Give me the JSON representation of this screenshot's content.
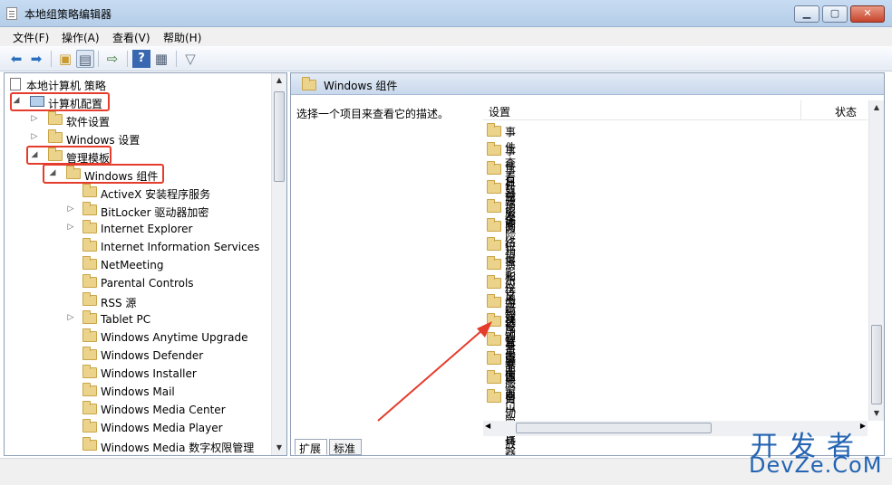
{
  "window": {
    "title": "本地组策略编辑器"
  },
  "menu": [
    "文件(F)",
    "操作(A)",
    "查看(V)",
    "帮助(H)"
  ],
  "tree": {
    "root": "本地计算机 策略",
    "computer_config": "计算机配置",
    "software_settings": "软件设置",
    "windows_settings": "Windows 设置",
    "admin_templates": "管理模板",
    "windows_components": "Windows 组件",
    "children": [
      {
        "label": "ActiveX 安装程序服务",
        "expandable": false
      },
      {
        "label": "BitLocker 驱动器加密",
        "expandable": true
      },
      {
        "label": "Internet Explorer",
        "expandable": true
      },
      {
        "label": "Internet Information Services",
        "expandable": false
      },
      {
        "label": "NetMeeting",
        "expandable": false
      },
      {
        "label": "Parental Controls",
        "expandable": false
      },
      {
        "label": "RSS 源",
        "expandable": false
      },
      {
        "label": "Tablet PC",
        "expandable": true
      },
      {
        "label": "Windows Anytime Upgrade",
        "expandable": false
      },
      {
        "label": "Windows Defender",
        "expandable": false
      },
      {
        "label": "Windows Installer",
        "expandable": false
      },
      {
        "label": "Windows Mail",
        "expandable": false
      },
      {
        "label": "Windows Media Center",
        "expandable": false
      },
      {
        "label": "Windows Media Player",
        "expandable": false
      },
      {
        "label": "Windows Media 数字权限管理",
        "expandable": false
      }
    ]
  },
  "right": {
    "header": "Windows 组件",
    "description": "选择一个项目来查看它的描述。",
    "col_setting": "设置",
    "col_status": "状态",
    "items": [
      "事件查看器",
      "事件日志服务",
      "事件转发",
      "数字保险箱",
      "搜索",
      "网络投影仪",
      "位置和传感器",
      "演示文稿设置",
      "应用程序兼容性",
      "游戏浏览器",
      "远程桌面服务",
      "智能卡",
      "桌面窗口管理器",
      "桌面小工具",
      "自动播放策略"
    ],
    "tabs": [
      "扩展",
      "标准"
    ]
  },
  "watermark": {
    "line1": "开发者",
    "line2": "DevZe.CoM"
  },
  "colors": {
    "highlight": "#e53c2b",
    "accent": "#2464b2"
  }
}
